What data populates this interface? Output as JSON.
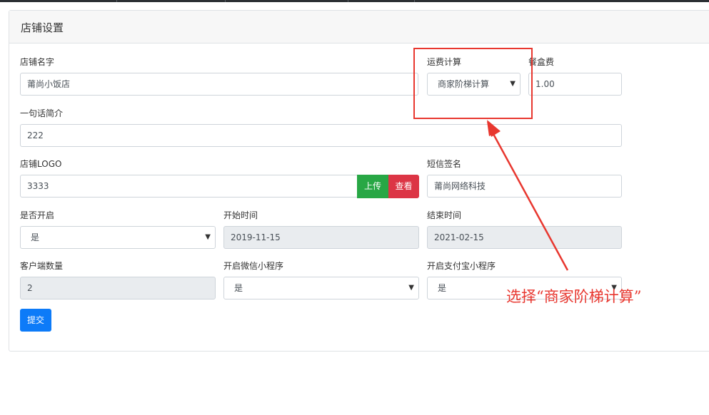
{
  "page": {
    "title": "店铺设置"
  },
  "form": {
    "store_name": {
      "label": "店铺名字",
      "value": "莆尚小饭店"
    },
    "shipping": {
      "label": "运费计算",
      "selected": "商家阶梯计算"
    },
    "box_fee": {
      "label": "餐盒费",
      "value": "1.00"
    },
    "intro": {
      "label": "一句话简介",
      "value": "222"
    },
    "logo": {
      "label": "店铺LOGO",
      "value": "3333",
      "upload_label": "上传",
      "view_label": "查看"
    },
    "sms_sign": {
      "label": "短信签名",
      "value": "莆尚网络科技"
    },
    "is_open": {
      "label": "是否开启",
      "selected": "是"
    },
    "start_time": {
      "label": "开始时间",
      "value": "2019-11-15"
    },
    "end_time": {
      "label": "结束时间",
      "value": "2021-02-15"
    },
    "client_count": {
      "label": "客户端数量",
      "value": "2"
    },
    "wechat_mini": {
      "label": "开启微信小程序",
      "selected": "是"
    },
    "alipay_mini": {
      "label": "开启支付宝小程序",
      "selected": "是"
    },
    "submit_label": "提交"
  },
  "annotation": {
    "text": "选择“商家阶梯计算”",
    "color": "#e8372f"
  },
  "colors": {
    "upload": "#28a745",
    "view": "#dc3545",
    "submit": "#0d7bf8"
  },
  "icons": {
    "caret": "caret-down-icon"
  }
}
